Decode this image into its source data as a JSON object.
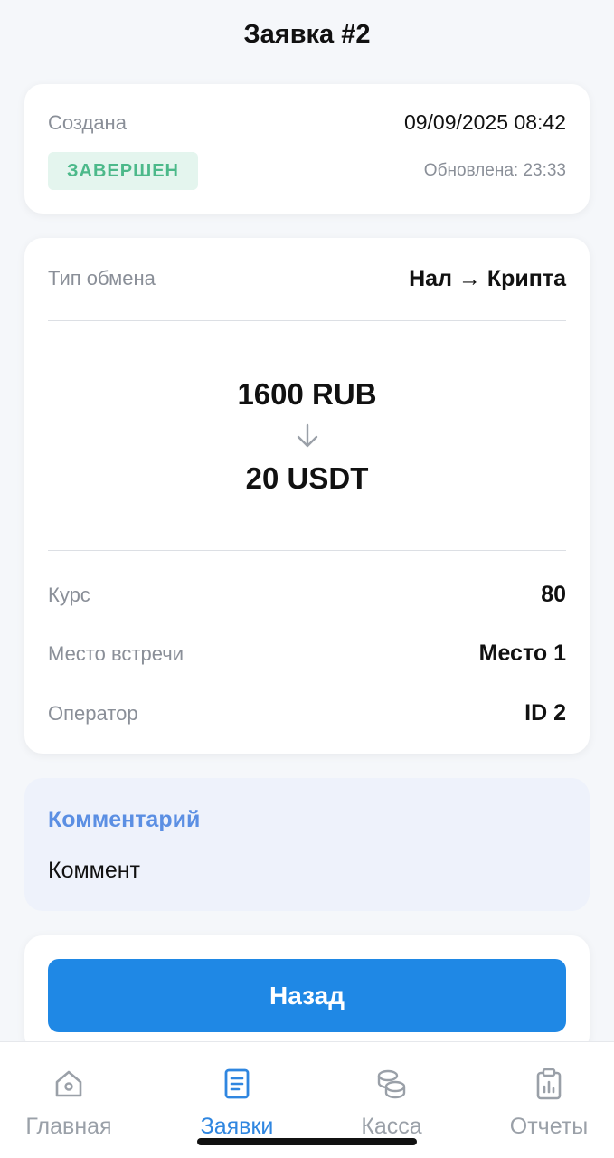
{
  "header": {
    "title": "Заявка #2"
  },
  "status": {
    "created_label": "Создана",
    "created_date": "09/09/2025 08:42",
    "badge": "ЗАВЕРШЕН",
    "updated": "Обновлена: 23:33"
  },
  "details": {
    "exchange_type_label": "Тип обмена",
    "exchange_type_value": "Нал → Крипта",
    "amount_from": "1600 RUB",
    "amount_to": "20 USDT",
    "rate_label": "Курс",
    "rate_value": "80",
    "place_label": "Место встречи",
    "place_value": "Место 1",
    "operator_label": "Оператор",
    "operator_value": "ID 2"
  },
  "comment": {
    "title": "Комментарий",
    "text": "Коммент"
  },
  "actions": {
    "back_label": "Назад"
  },
  "tabbar": {
    "tabs": [
      {
        "label": "Главная",
        "icon": "home-icon",
        "active": false
      },
      {
        "label": "Заявки",
        "icon": "document-icon",
        "active": true
      },
      {
        "label": "Касса",
        "icon": "coins-icon",
        "active": false
      },
      {
        "label": "Отчеты",
        "icon": "report-clipboard-icon",
        "active": false
      }
    ]
  },
  "colors": {
    "accent": "#1f88e5",
    "active_tab": "#2f86e0",
    "badge_bg": "#e4f5ee",
    "badge_text": "#4cb98a",
    "comment_title": "#5b8fe3",
    "comment_bg": "#eef2fb"
  }
}
